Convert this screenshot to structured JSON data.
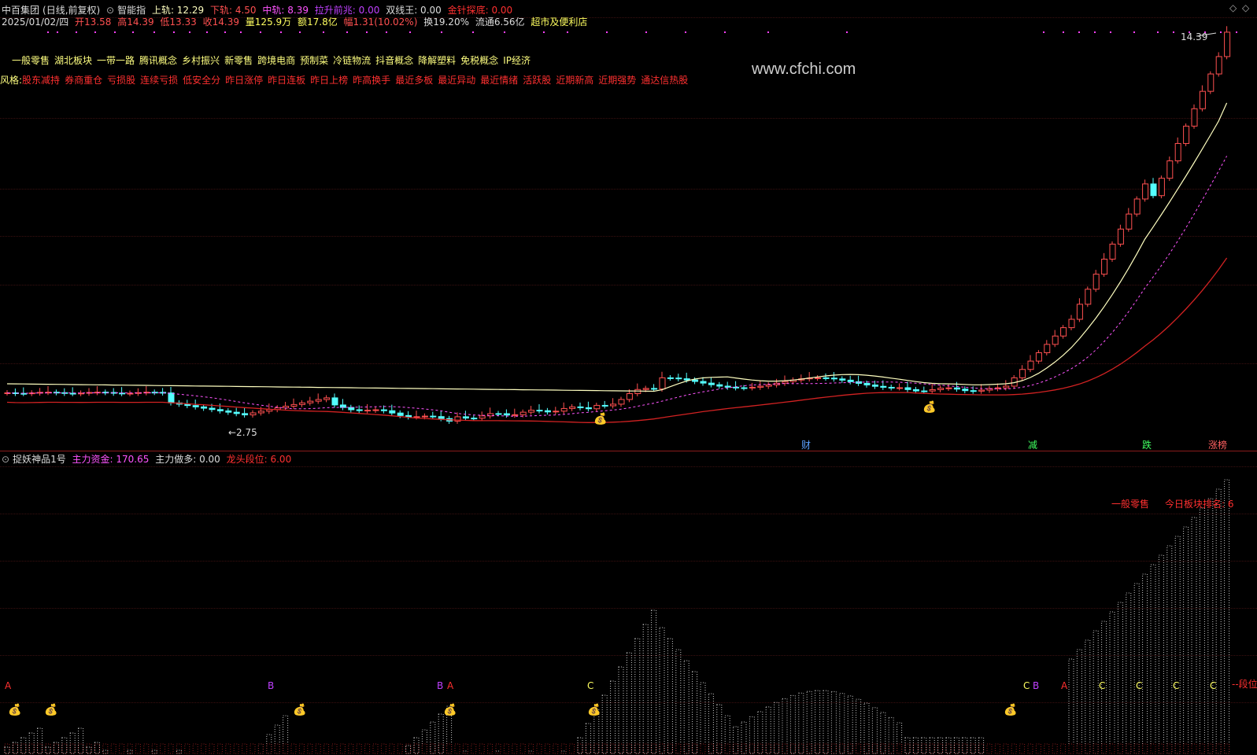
{
  "header": {
    "stock_name": "中百集团",
    "period": "(日线,前复权)",
    "indicator_name": "智能指",
    "upper_label": "上轨: 12.29",
    "lower_label": "下轨: 4.50",
    "mid_label": "中轨: 8.39",
    "signal_label": "拉升前兆: 0.00",
    "double_line_label": "双线王: 0.00",
    "needle_label": "金针探底: 0.00"
  },
  "quote": {
    "date": "2025/01/02/四",
    "open": "开13.58",
    "high": "高14.39",
    "low": "低13.33",
    "close": "收14.39",
    "volume": "量125.9万",
    "amount": "额17.8亿",
    "change": "幅1.31(10.02%)",
    "turnover": "换19.20%",
    "float": "流通6.56亿",
    "industry": "超市及便利店"
  },
  "concepts": [
    "一般零售",
    "湖北板块",
    "一带一路",
    "腾讯概念",
    "乡村振兴",
    "新零售",
    "跨境电商",
    "预制菜",
    "冷链物流",
    "抖音概念",
    "降解塑料",
    "免税概念",
    "IP经济"
  ],
  "style_label": "风格:",
  "styles": [
    "股东减持",
    "券商重仓",
    "亏损股",
    "连续亏损",
    "低安全分",
    "昨日涨停",
    "昨日连板",
    "昨日上榜",
    "昨高换手",
    "最近多板",
    "最近异动",
    "最近情绪",
    "活跃股",
    "近期新高",
    "近期强势",
    "通达信热股"
  ],
  "watermark": "www.cfchi.com",
  "price_labels": {
    "high": "14.39",
    "low": "←2.75"
  },
  "event_markers": [
    "财",
    "减",
    "跌",
    "涨榜"
  ],
  "sub_header": {
    "name": "捉妖神品1号",
    "fund_label": "主力资金: 170.65",
    "long_label": "主力做多: 0.00",
    "dragon_label": "龙头段位: 6.00"
  },
  "sub_annotations": {
    "sector": "一般零售",
    "rank_label": "今日板块排名:",
    "rank_value": "6",
    "segment_label": "--段位"
  },
  "sub_letters": [
    "A",
    "B",
    "B",
    "A",
    "C",
    "C",
    "B",
    "A",
    "C",
    "C",
    "C",
    "C"
  ],
  "icons": {
    "coin": "money-bag-icon",
    "collapse": "circle-chevron-icon",
    "window": "diamond-icon"
  },
  "colors": {
    "up": "#ff5050",
    "down": "#54ffff",
    "ma": "#ffffc0",
    "mid": "#ff54ff",
    "lower": "#d22222",
    "bars": "#c8c8c8"
  },
  "chart_data": {
    "type": "candlestick",
    "title": "中百集团 (日线,前复权)",
    "last_close": 14.39,
    "overlays": [
      "上轨",
      "下轨",
      "中轨"
    ],
    "sub_chart": {
      "name": "捉妖神品1号",
      "type": "bar",
      "series": [
        "主力资金"
      ]
    }
  }
}
